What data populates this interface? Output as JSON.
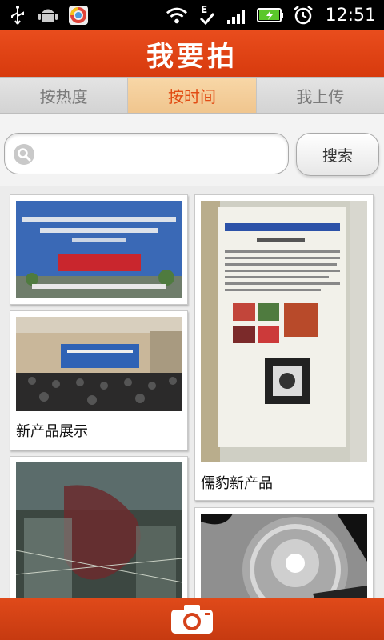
{
  "status_bar": {
    "time": "12:51",
    "icons": [
      "usb-icon",
      "android-debug-icon",
      "app-notification-icon",
      "wifi-icon",
      "sync-icon",
      "signal-icon",
      "battery-charging-icon",
      "alarm-icon"
    ]
  },
  "header": {
    "title": "我要拍"
  },
  "tabs": [
    {
      "label": "按热度",
      "active": false
    },
    {
      "label": "按时间",
      "active": true
    },
    {
      "label": "我上传",
      "active": false
    }
  ],
  "search": {
    "value": "",
    "placeholder": "",
    "button_label": "搜索"
  },
  "posts": [
    {
      "caption": ""
    },
    {
      "caption": "新产品展示"
    },
    {
      "caption": ""
    },
    {
      "caption": "儒豹新产品"
    },
    {
      "caption": ""
    }
  ],
  "bottom_bar": {
    "camera_icon": "camera-icon"
  },
  "colors": {
    "accent": "#e24c14",
    "active_tab_bg": "#f0c58e",
    "header_bg": "#d73a0d"
  }
}
